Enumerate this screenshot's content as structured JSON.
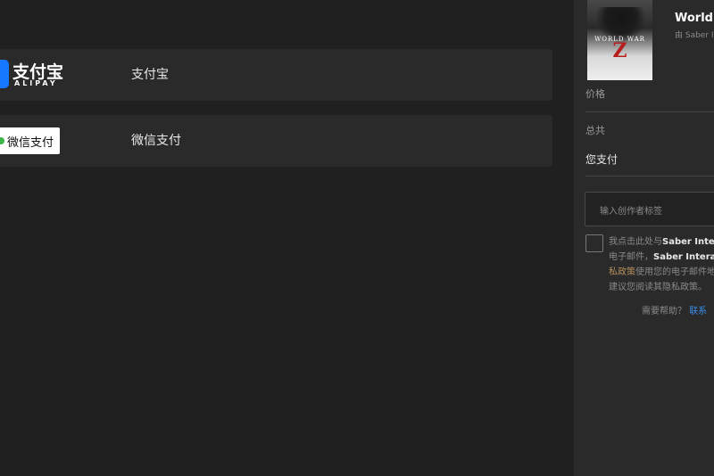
{
  "payment_methods": [
    {
      "logo_cn": "支付宝",
      "logo_en": "ALIPAY",
      "label": "支付宝"
    },
    {
      "logo_text": "微信支付",
      "label": "微信支付"
    }
  ],
  "summary": {
    "cover_title": "WORLD WAR",
    "cover_letter": "Z",
    "game_title": "World W",
    "publisher": "由 Saber I",
    "price_label": "价格",
    "total_label": "总共",
    "you_pay_label": "您支付",
    "creator_code_placeholder": "输入创作者标签",
    "consent_line1_pre": "我点击此处与",
    "consent_line1_bold": "Saber Inter",
    "consent_line2_pre": "电子邮件，",
    "consent_line2_bold": "Saber Interac",
    "consent_line3_link": "私政策",
    "consent_line3_rest": "使用您的电子邮件地",
    "consent_line4": "建议您阅读其隐私政策。",
    "help_text": "需要帮助？",
    "help_link": "联系"
  },
  "colors": {
    "background": "#202020",
    "row": "#2a2a2a",
    "alipay_blue": "#1677ff",
    "wechat_green": "#3bb54a",
    "link_blue": "#3b8eea"
  }
}
